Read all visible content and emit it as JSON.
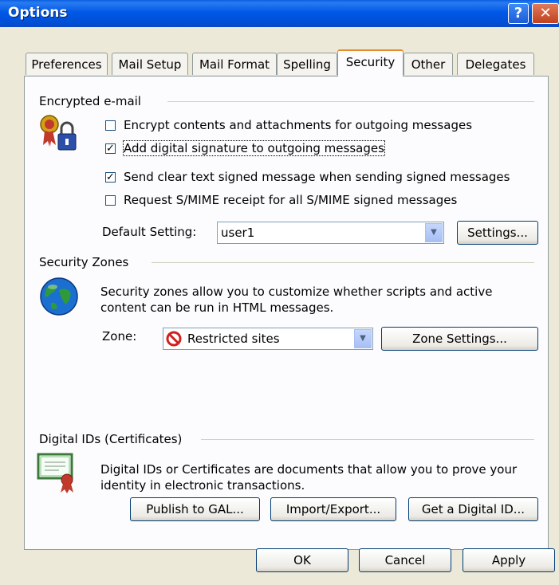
{
  "window": {
    "title": "Options"
  },
  "titlebar": {
    "help_glyph": "?",
    "close_glyph": "✕"
  },
  "tabs": [
    {
      "label": "Preferences"
    },
    {
      "label": "Mail Setup"
    },
    {
      "label": "Mail Format"
    },
    {
      "label": "Spelling"
    },
    {
      "label": "Security",
      "active": true
    },
    {
      "label": "Other"
    },
    {
      "label": "Delegates"
    }
  ],
  "encrypted": {
    "heading": "Encrypted e-mail",
    "options": [
      {
        "label": "Encrypt contents and attachments for outgoing messages",
        "checked": false
      },
      {
        "label": "Add digital signature to outgoing messages",
        "checked": true
      },
      {
        "label": "Send clear text signed message when sending signed messages",
        "checked": true
      },
      {
        "label": "Request S/MIME receipt for all S/MIME signed messages",
        "checked": false
      }
    ],
    "default_setting_label": "Default Setting:",
    "default_setting_value": "user1",
    "settings_button": "Settings..."
  },
  "zones": {
    "heading": "Security Zones",
    "description_line1": "Security zones allow you to customize whether scripts and active",
    "description_line2": "content can be run in HTML messages.",
    "zone_label": "Zone:",
    "zone_value": "Restricted sites",
    "zone_settings_button": "Zone Settings..."
  },
  "digital_ids": {
    "heading": "Digital IDs (Certificates)",
    "description_line1": "Digital IDs or Certificates are documents that allow you to prove your",
    "description_line2": "identity in electronic transactions.",
    "publish_button": "Publish to GAL...",
    "import_export_button": "Import/Export...",
    "get_id_button": "Get a Digital ID..."
  },
  "footer": {
    "ok": "OK",
    "cancel": "Cancel",
    "apply": "Apply"
  },
  "colors": {
    "titlebar": "#0058e6",
    "panel_bg": "#fcfcfe",
    "dialog_bg": "#ece9d8",
    "active_tab_accent": "#e68b2c"
  }
}
